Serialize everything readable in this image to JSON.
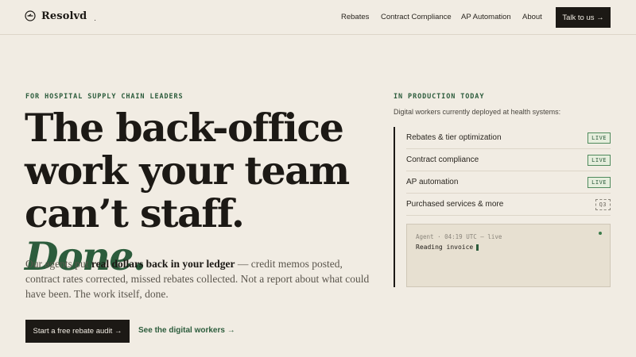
{
  "brand": {
    "name": "Resolvd",
    "mark": ".",
    "logo_icon": "compass-icon"
  },
  "nav": {
    "items": [
      "Rebates",
      "Contract Compliance",
      "AP Automation",
      "About"
    ],
    "cta": "Talk to us →"
  },
  "hero": {
    "eyebrow": "FOR HOSPITAL SUPPLY CHAIN LEADERS",
    "headline_line1": "The back-office",
    "headline_line2": "work your team",
    "headline_line3_a": "can’t staff.",
    "headline_line3_b": "Done.",
    "body_a": "Our agents put ",
    "body_bold": "real dollars back in your ledger",
    "body_b": " — credit memos posted, contract rates corrected, missed rebates collected. Not a report about what could have been. The work itself, done.",
    "cta_primary": "Start a free rebate audit →",
    "cta_secondary": "See the digital workers →"
  },
  "production": {
    "label": "IN PRODUCTION TODAY",
    "subtitle": "Digital workers currently deployed at health systems:",
    "items": [
      {
        "label": "Rebates & tier optimization",
        "status": "LIVE"
      },
      {
        "label": "Contract compliance",
        "status": "LIVE"
      },
      {
        "label": "AP automation",
        "status": "LIVE"
      },
      {
        "label": "Purchased services & more",
        "status": "Q3"
      }
    ],
    "console": {
      "meta": "Agent · 04:19 UTC — live",
      "line": "Reading invoice"
    }
  },
  "colors": {
    "background": "#f1ece3",
    "ink": "#1c1915",
    "accent": "#2c5c3c"
  }
}
